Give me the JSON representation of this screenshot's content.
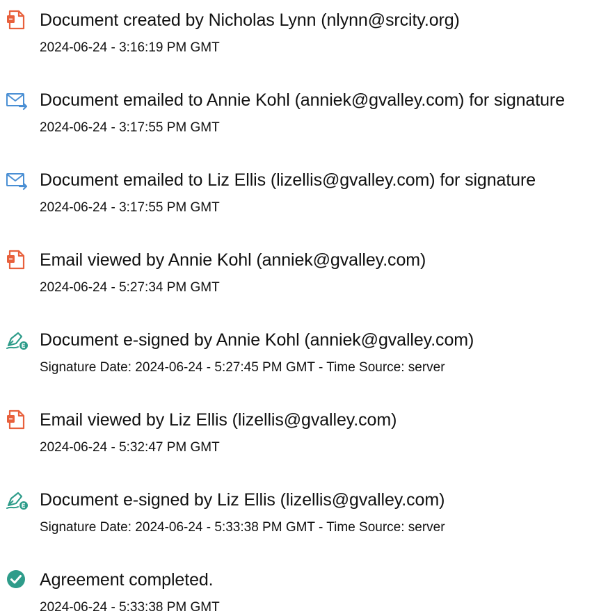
{
  "events": [
    {
      "icon": "document-icon",
      "title": "Document created by Nicholas Lynn (nlynn@srcity.org)",
      "detail": "2024-06-24 - 3:16:19 PM GMT"
    },
    {
      "icon": "email-sent-icon",
      "title": "Document emailed to Annie Kohl (anniek@gvalley.com) for signature",
      "detail": "2024-06-24 - 3:17:55 PM GMT"
    },
    {
      "icon": "email-sent-icon",
      "title": "Document emailed to Liz Ellis (lizellis@gvalley.com) for signature",
      "detail": "2024-06-24 - 3:17:55 PM GMT"
    },
    {
      "icon": "document-icon",
      "title": "Email viewed by Annie Kohl (anniek@gvalley.com)",
      "detail": "2024-06-24 - 5:27:34 PM GMT"
    },
    {
      "icon": "esign-pen-icon",
      "title": "Document e-signed by Annie Kohl (anniek@gvalley.com)",
      "detail": "Signature Date: 2024-06-24 - 5:27:45 PM GMT - Time Source: server"
    },
    {
      "icon": "document-icon",
      "title": "Email viewed by Liz Ellis (lizellis@gvalley.com)",
      "detail": "2024-06-24 - 5:32:47 PM GMT"
    },
    {
      "icon": "esign-pen-icon",
      "title": "Document e-signed by Liz Ellis (lizellis@gvalley.com)",
      "detail": "Signature Date: 2024-06-24 - 5:33:38 PM GMT - Time Source: server"
    },
    {
      "icon": "check-circle-icon",
      "title": "Agreement completed.",
      "detail": "2024-06-24 - 5:33:38 PM GMT"
    }
  ],
  "colors": {
    "document_icon": "#E8603C",
    "email_icon": "#4A8FD4",
    "esign_icon": "#2E9C8A",
    "check_icon": "#2E9C8A",
    "text": "#111111"
  }
}
